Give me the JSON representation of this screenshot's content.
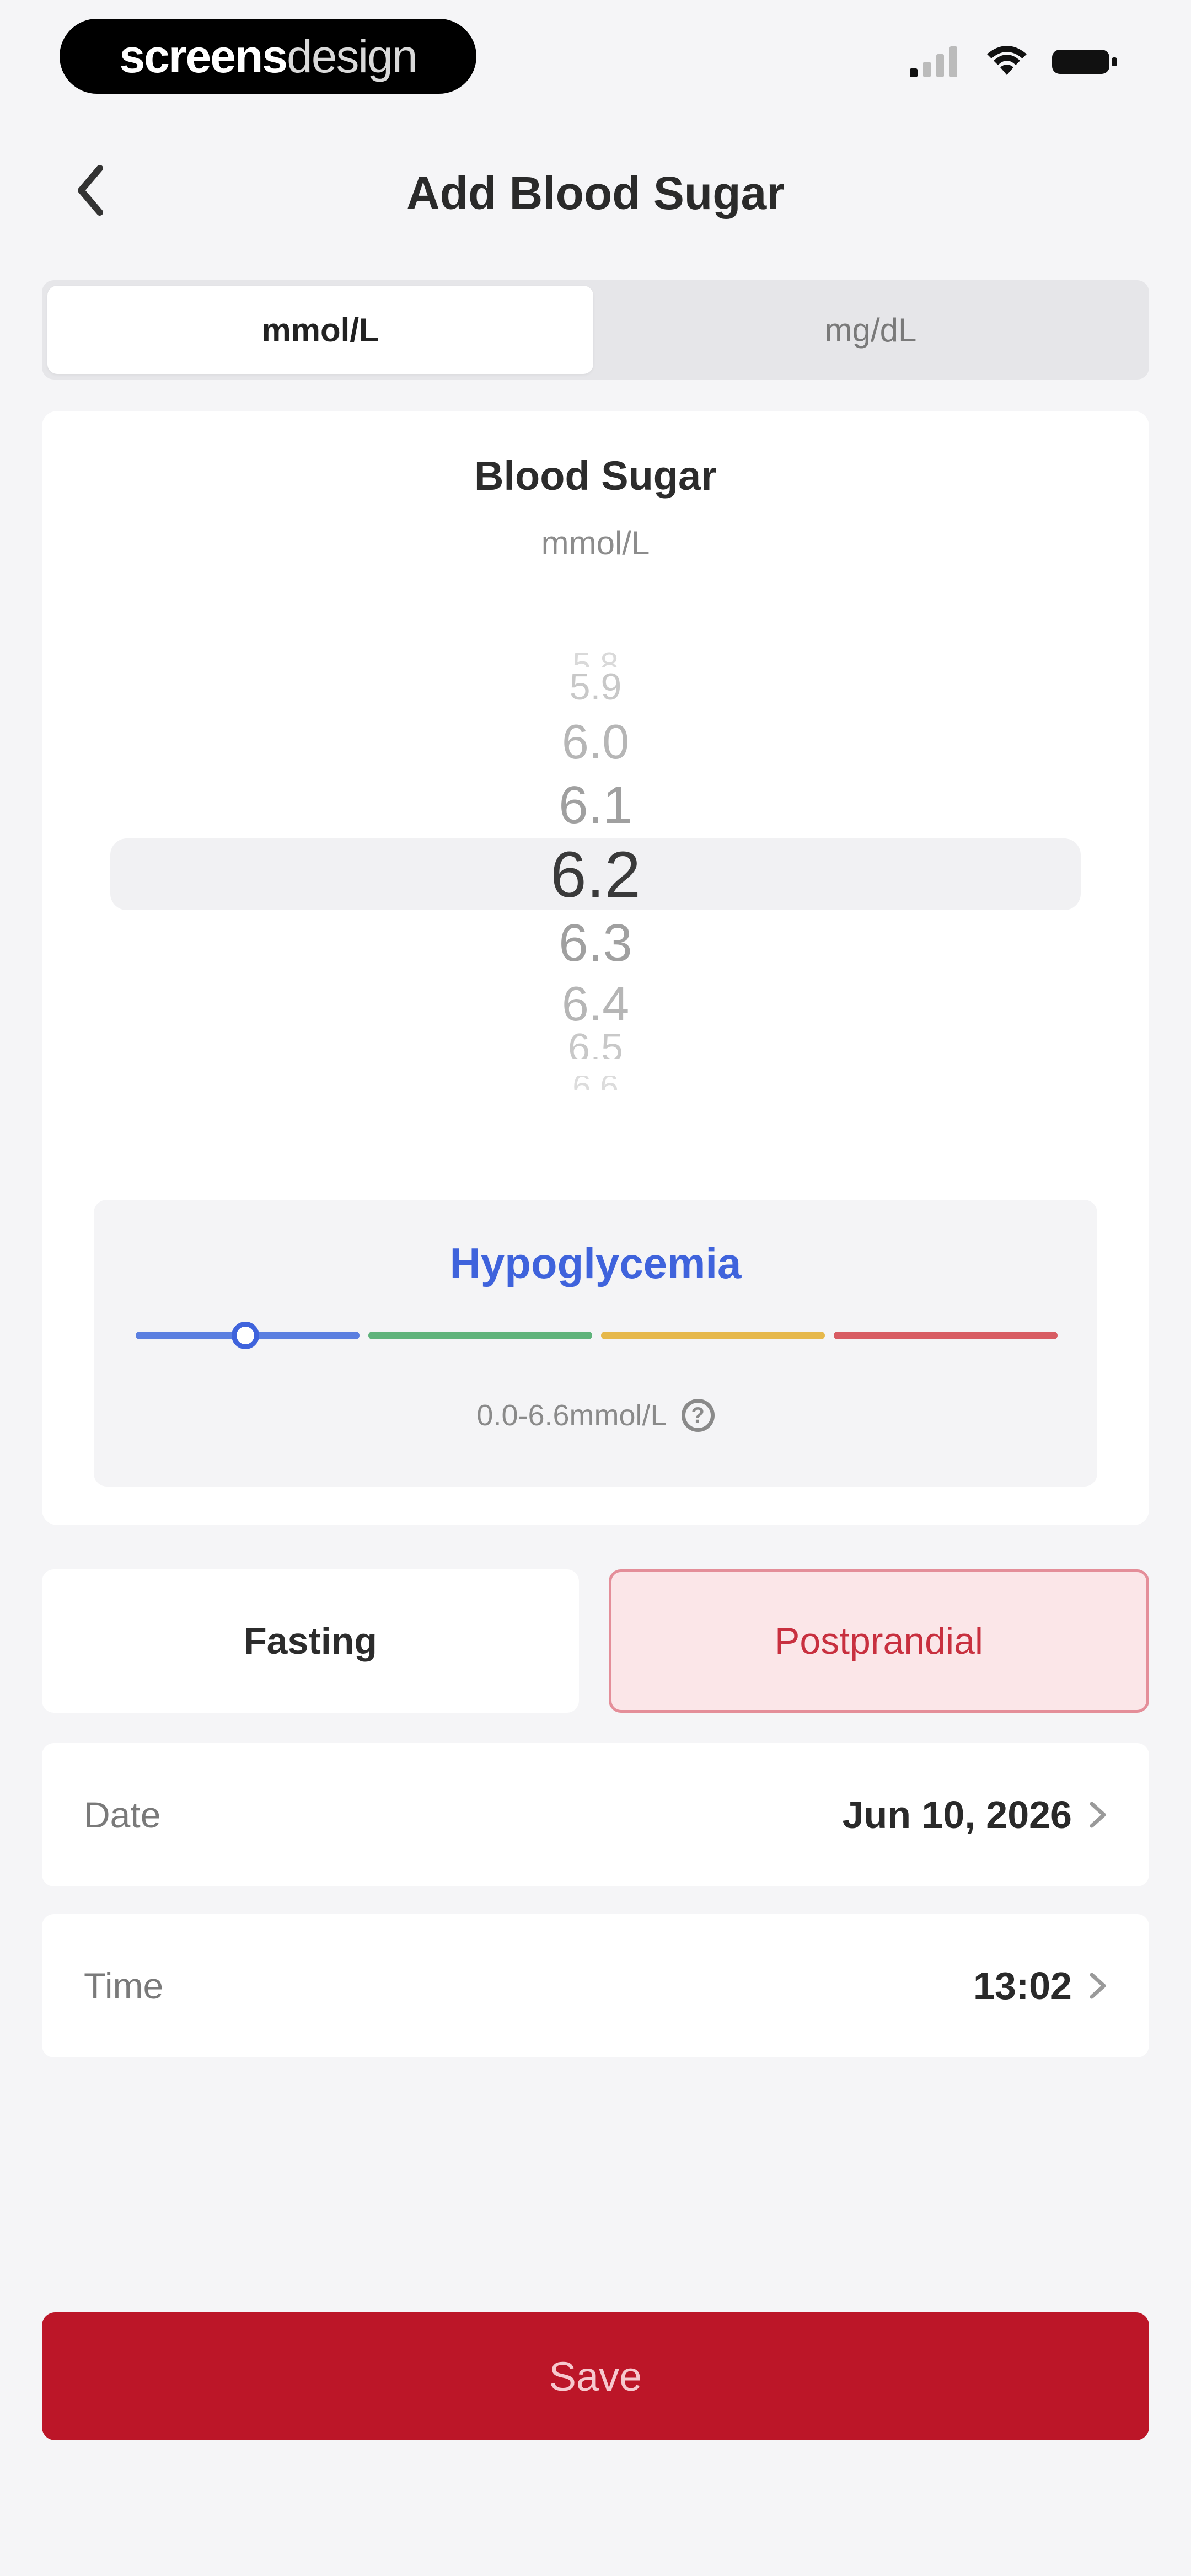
{
  "status_bar": {
    "brand_bold": "screens",
    "brand_light": "design"
  },
  "header": {
    "title": "Add Blood Sugar"
  },
  "unit_switch": {
    "options": [
      "mmol/L",
      "mg/dL"
    ],
    "selected": "mmol/L"
  },
  "reading": {
    "title": "Blood Sugar",
    "unit": "mmol/L",
    "picker_values": [
      "5.8",
      "5.9",
      "6.0",
      "6.1",
      "6.2",
      "6.3",
      "6.4",
      "6.5",
      "6.6"
    ],
    "selected_value": "6.2"
  },
  "range": {
    "label": "Hypoglycemia",
    "text": "0.0-6.6mmol/L",
    "segment_colors": [
      "#5b7fe0",
      "#5fb37b",
      "#e6b84b",
      "#d85c63"
    ],
    "accent_color": "#3f63dc"
  },
  "meal": {
    "options": [
      "Fasting",
      "Postprandial"
    ],
    "selected": "Postprandial"
  },
  "fields": {
    "date_label": "Date",
    "date_value": "Jun 10, 2026",
    "time_label": "Time",
    "time_value": "13:02"
  },
  "actions": {
    "save_label": "Save",
    "save_color": "#bc1628"
  }
}
